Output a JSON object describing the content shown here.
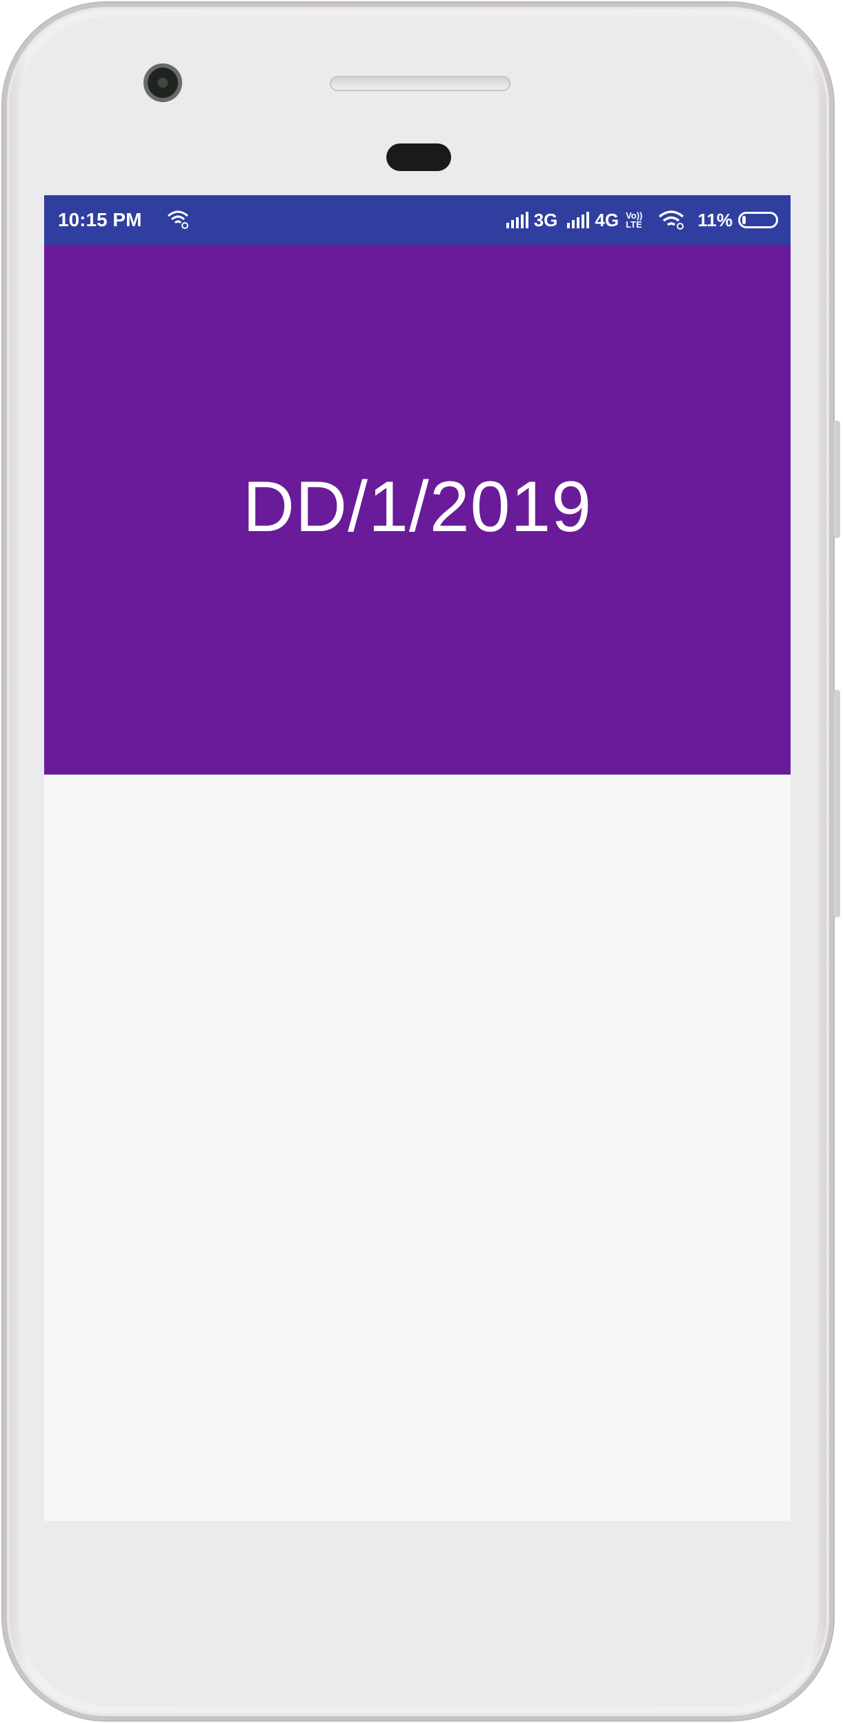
{
  "status_bar": {
    "time": "10:15 PM",
    "network_1": "3G",
    "network_2": "4G",
    "volte_top": "Vo))",
    "volte_bottom": "LTE",
    "battery": "11%",
    "battery_level": 0.11,
    "background_color": "#303f9f"
  },
  "main": {
    "date_display": "DD/1/2019",
    "header_color": "#6a1b9a",
    "body_color": "#f8f8f9"
  }
}
